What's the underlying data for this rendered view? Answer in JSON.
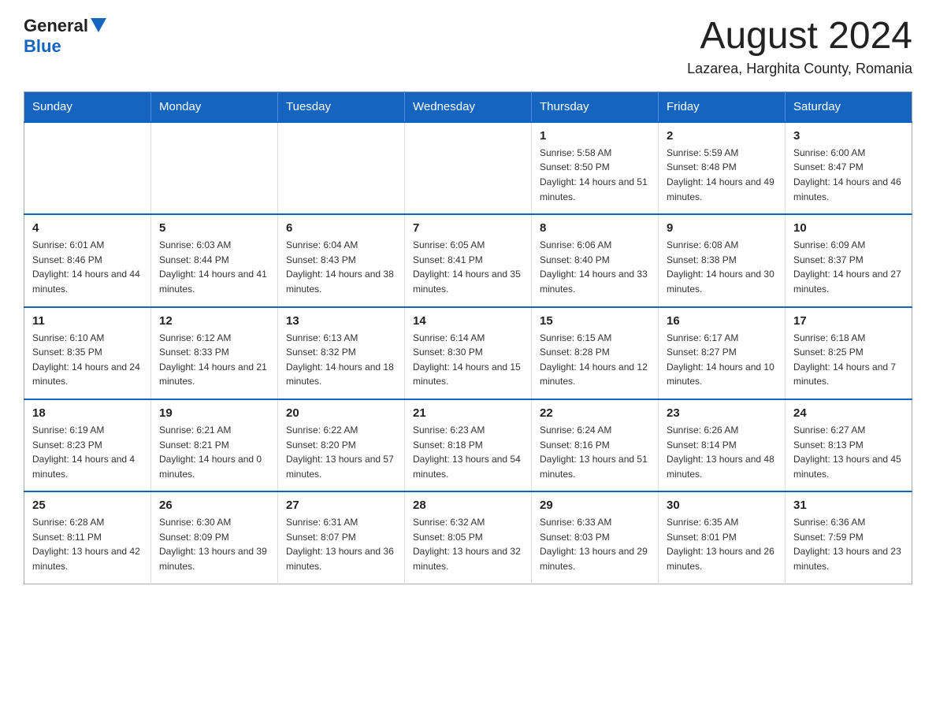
{
  "header": {
    "logo_general": "General",
    "logo_blue": "Blue",
    "month_title": "August 2024",
    "location": "Lazarea, Harghita County, Romania"
  },
  "weekdays": [
    "Sunday",
    "Monday",
    "Tuesday",
    "Wednesday",
    "Thursday",
    "Friday",
    "Saturday"
  ],
  "weeks": [
    [
      {
        "day": "",
        "info": ""
      },
      {
        "day": "",
        "info": ""
      },
      {
        "day": "",
        "info": ""
      },
      {
        "day": "",
        "info": ""
      },
      {
        "day": "1",
        "info": "Sunrise: 5:58 AM\nSunset: 8:50 PM\nDaylight: 14 hours and 51 minutes."
      },
      {
        "day": "2",
        "info": "Sunrise: 5:59 AM\nSunset: 8:48 PM\nDaylight: 14 hours and 49 minutes."
      },
      {
        "day": "3",
        "info": "Sunrise: 6:00 AM\nSunset: 8:47 PM\nDaylight: 14 hours and 46 minutes."
      }
    ],
    [
      {
        "day": "4",
        "info": "Sunrise: 6:01 AM\nSunset: 8:46 PM\nDaylight: 14 hours and 44 minutes."
      },
      {
        "day": "5",
        "info": "Sunrise: 6:03 AM\nSunset: 8:44 PM\nDaylight: 14 hours and 41 minutes."
      },
      {
        "day": "6",
        "info": "Sunrise: 6:04 AM\nSunset: 8:43 PM\nDaylight: 14 hours and 38 minutes."
      },
      {
        "day": "7",
        "info": "Sunrise: 6:05 AM\nSunset: 8:41 PM\nDaylight: 14 hours and 35 minutes."
      },
      {
        "day": "8",
        "info": "Sunrise: 6:06 AM\nSunset: 8:40 PM\nDaylight: 14 hours and 33 minutes."
      },
      {
        "day": "9",
        "info": "Sunrise: 6:08 AM\nSunset: 8:38 PM\nDaylight: 14 hours and 30 minutes."
      },
      {
        "day": "10",
        "info": "Sunrise: 6:09 AM\nSunset: 8:37 PM\nDaylight: 14 hours and 27 minutes."
      }
    ],
    [
      {
        "day": "11",
        "info": "Sunrise: 6:10 AM\nSunset: 8:35 PM\nDaylight: 14 hours and 24 minutes."
      },
      {
        "day": "12",
        "info": "Sunrise: 6:12 AM\nSunset: 8:33 PM\nDaylight: 14 hours and 21 minutes."
      },
      {
        "day": "13",
        "info": "Sunrise: 6:13 AM\nSunset: 8:32 PM\nDaylight: 14 hours and 18 minutes."
      },
      {
        "day": "14",
        "info": "Sunrise: 6:14 AM\nSunset: 8:30 PM\nDaylight: 14 hours and 15 minutes."
      },
      {
        "day": "15",
        "info": "Sunrise: 6:15 AM\nSunset: 8:28 PM\nDaylight: 14 hours and 12 minutes."
      },
      {
        "day": "16",
        "info": "Sunrise: 6:17 AM\nSunset: 8:27 PM\nDaylight: 14 hours and 10 minutes."
      },
      {
        "day": "17",
        "info": "Sunrise: 6:18 AM\nSunset: 8:25 PM\nDaylight: 14 hours and 7 minutes."
      }
    ],
    [
      {
        "day": "18",
        "info": "Sunrise: 6:19 AM\nSunset: 8:23 PM\nDaylight: 14 hours and 4 minutes."
      },
      {
        "day": "19",
        "info": "Sunrise: 6:21 AM\nSunset: 8:21 PM\nDaylight: 14 hours and 0 minutes."
      },
      {
        "day": "20",
        "info": "Sunrise: 6:22 AM\nSunset: 8:20 PM\nDaylight: 13 hours and 57 minutes."
      },
      {
        "day": "21",
        "info": "Sunrise: 6:23 AM\nSunset: 8:18 PM\nDaylight: 13 hours and 54 minutes."
      },
      {
        "day": "22",
        "info": "Sunrise: 6:24 AM\nSunset: 8:16 PM\nDaylight: 13 hours and 51 minutes."
      },
      {
        "day": "23",
        "info": "Sunrise: 6:26 AM\nSunset: 8:14 PM\nDaylight: 13 hours and 48 minutes."
      },
      {
        "day": "24",
        "info": "Sunrise: 6:27 AM\nSunset: 8:13 PM\nDaylight: 13 hours and 45 minutes."
      }
    ],
    [
      {
        "day": "25",
        "info": "Sunrise: 6:28 AM\nSunset: 8:11 PM\nDaylight: 13 hours and 42 minutes."
      },
      {
        "day": "26",
        "info": "Sunrise: 6:30 AM\nSunset: 8:09 PM\nDaylight: 13 hours and 39 minutes."
      },
      {
        "day": "27",
        "info": "Sunrise: 6:31 AM\nSunset: 8:07 PM\nDaylight: 13 hours and 36 minutes."
      },
      {
        "day": "28",
        "info": "Sunrise: 6:32 AM\nSunset: 8:05 PM\nDaylight: 13 hours and 32 minutes."
      },
      {
        "day": "29",
        "info": "Sunrise: 6:33 AM\nSunset: 8:03 PM\nDaylight: 13 hours and 29 minutes."
      },
      {
        "day": "30",
        "info": "Sunrise: 6:35 AM\nSunset: 8:01 PM\nDaylight: 13 hours and 26 minutes."
      },
      {
        "day": "31",
        "info": "Sunrise: 6:36 AM\nSunset: 7:59 PM\nDaylight: 13 hours and 23 minutes."
      }
    ]
  ]
}
